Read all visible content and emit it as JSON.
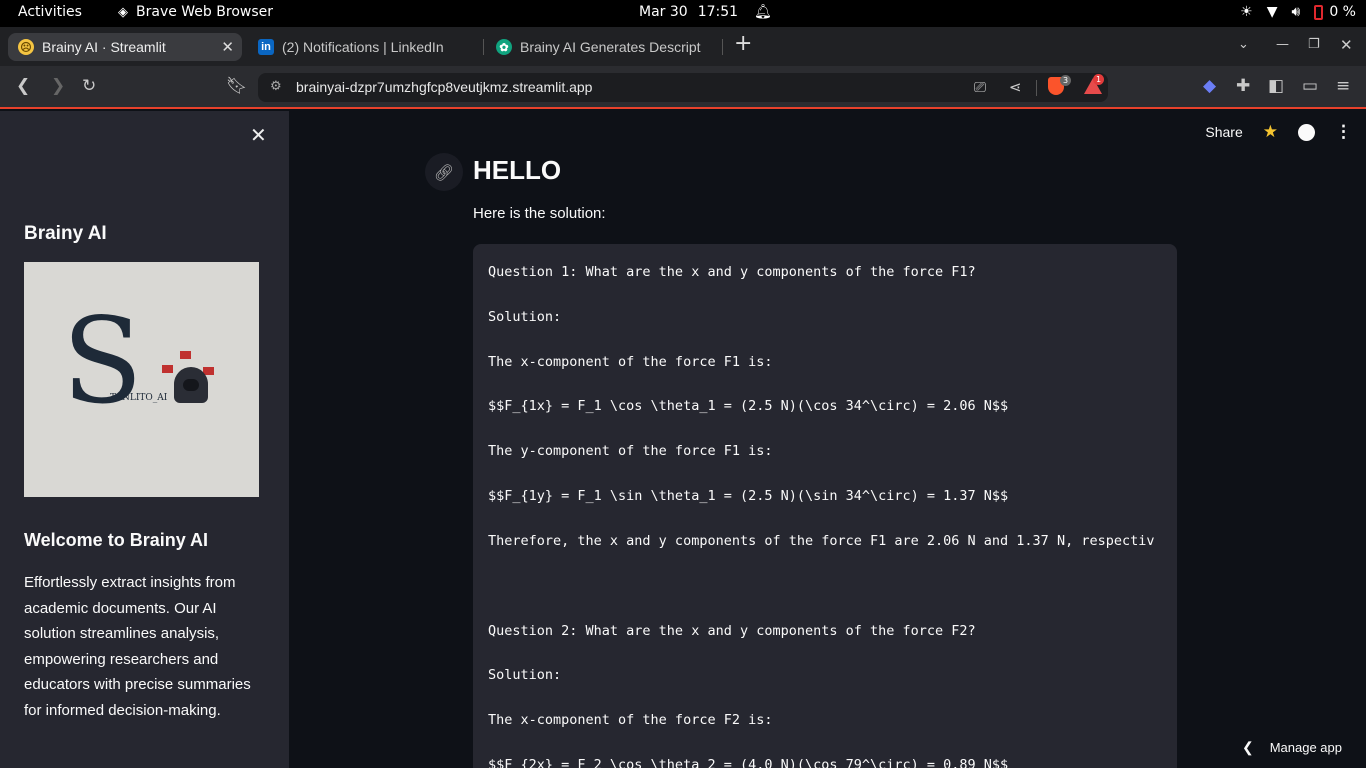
{
  "system_bar": {
    "activities": "Activities",
    "app_name": "Brave Web Browser",
    "date": "Mar 30",
    "time": "17:51",
    "battery": "0 %"
  },
  "tabs": [
    {
      "title": "Brainy AI · Streamlit",
      "icon": "streamlit-emoji-icon"
    },
    {
      "title": "(2) Notifications | LinkedIn",
      "icon": "linkedin-icon"
    },
    {
      "title": "Brainy AI Generates Descript",
      "icon": "chatgpt-icon"
    }
  ],
  "toolbar": {
    "url": "brainyai-dzpr7umzhgfcp8veutjkmz.streamlit.app",
    "shields_count": "3",
    "rewards_count": "1"
  },
  "sidebar": {
    "app_title": "Brainy AI",
    "logo_letter": "S",
    "logo_text": "TANLITO_AI",
    "welcome_heading": "Welcome to Brainy AI",
    "description": "Effortlessly extract insights from academic documents. Our AI solution streamlines analysis, empowering researchers and educators with precise summaries for informed decision-making."
  },
  "main": {
    "share_label": "Share",
    "heading": "HELLO",
    "intro": "Here is the solution:",
    "solution_lines": [
      "Question 1: What are the x and y components of the force F1?",
      "",
      "Solution:",
      "",
      "The x-component of the force F1 is:",
      "",
      "$$F_{1x} = F_1 \\cos \\theta_1 = (2.5 N)(\\cos 34^\\circ) = 2.06 N$$",
      "",
      "The y-component of the force F1 is:",
      "",
      "$$F_{1y} = F_1 \\sin \\theta_1 = (2.5 N)(\\sin 34^\\circ) = 1.37 N$$",
      "",
      "Therefore, the x and y components of the force F1 are 2.06 N and 1.37 N, respectiv",
      "",
      "",
      "",
      "Question 2: What are the x and y components of the force F2?",
      "",
      "Solution:",
      "",
      "The x-component of the force F2 is:",
      "",
      "$$F_{2x} = F_2 \\cos \\theta_2 = (4.0 N)(\\cos 79^\\circ) = 0.89 N$$"
    ],
    "manage_app_label": "Manage app"
  }
}
